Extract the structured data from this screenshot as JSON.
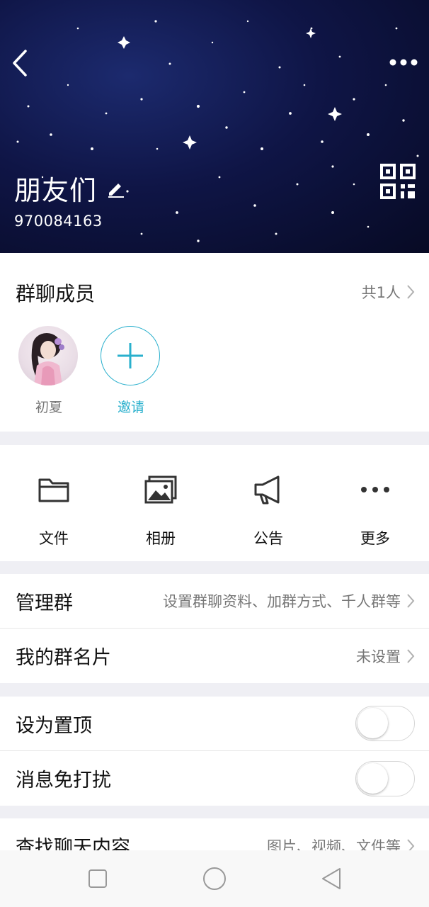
{
  "header": {
    "group_name": "朋友们",
    "group_id": "970084163"
  },
  "members": {
    "title": "群聊成员",
    "count": "共1人",
    "list": [
      {
        "name": "初夏"
      }
    ],
    "invite_label": "邀请"
  },
  "tools": [
    {
      "label": "文件",
      "icon": "folder-icon"
    },
    {
      "label": "相册",
      "icon": "photo-album-icon"
    },
    {
      "label": "公告",
      "icon": "megaphone-icon"
    },
    {
      "label": "更多",
      "icon": "more-dots-icon"
    }
  ],
  "settings": {
    "manage": {
      "label": "管理群",
      "value": "设置群聊资料、加群方式、千人群等"
    },
    "card_name": {
      "label": "我的群名片",
      "value": "未设置"
    },
    "pin": {
      "label": "设为置顶",
      "on": false
    },
    "mute": {
      "label": "消息免打扰",
      "on": false
    },
    "search": {
      "label": "查找聊天内容",
      "value": "图片、视频、文件等"
    }
  },
  "colors": {
    "accent": "#2ab0cd",
    "header_bg": "#0f1546"
  }
}
